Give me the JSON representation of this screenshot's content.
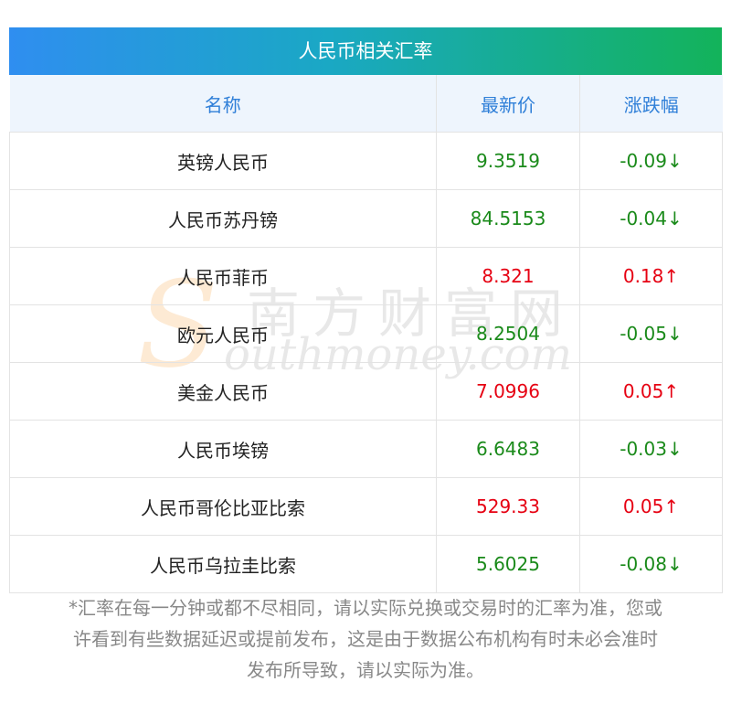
{
  "header": {
    "title": "人民币相关汇率"
  },
  "table": {
    "columns": [
      "名称",
      "最新价",
      "涨跌幅"
    ],
    "rows": [
      {
        "name": "英镑人民币",
        "price": "9.3519",
        "change": "-0.09↓",
        "dir": "down"
      },
      {
        "name": "人民币苏丹镑",
        "price": "84.5153",
        "change": "-0.04↓",
        "dir": "down"
      },
      {
        "name": "人民币菲币",
        "price": "8.321",
        "change": "0.18↑",
        "dir": "up"
      },
      {
        "name": "欧元人民币",
        "price": "8.2504",
        "change": "-0.05↓",
        "dir": "down"
      },
      {
        "name": "美金人民币",
        "price": "7.0996",
        "change": "0.05↑",
        "dir": "up"
      },
      {
        "name": "人民币埃镑",
        "price": "6.6483",
        "change": "-0.03↓",
        "dir": "down"
      },
      {
        "name": "人民币哥伦比亚比索",
        "price": "529.33",
        "change": "0.05↑",
        "dir": "up"
      },
      {
        "name": "人民币乌拉圭比索",
        "price": "5.6025",
        "change": "-0.08↓",
        "dir": "down"
      }
    ]
  },
  "watermark": {
    "s": "S",
    "cn": "南方财富网",
    "en": "outhmoney.com"
  },
  "footnote": {
    "line1": "*汇率在每一分钟或都不尽相同，请以实际兑换或交易时的汇率为准，您或",
    "line2": "许看到有些数据延迟或提前发布，这是由于数据公布机构有时未必会准时",
    "line3": "发布所导致，请以实际为准。"
  },
  "colors": {
    "up": "#e60012",
    "down": "#1a8a1a",
    "header_text": "#2f7fd8",
    "header_bg": "#eef5fd"
  }
}
